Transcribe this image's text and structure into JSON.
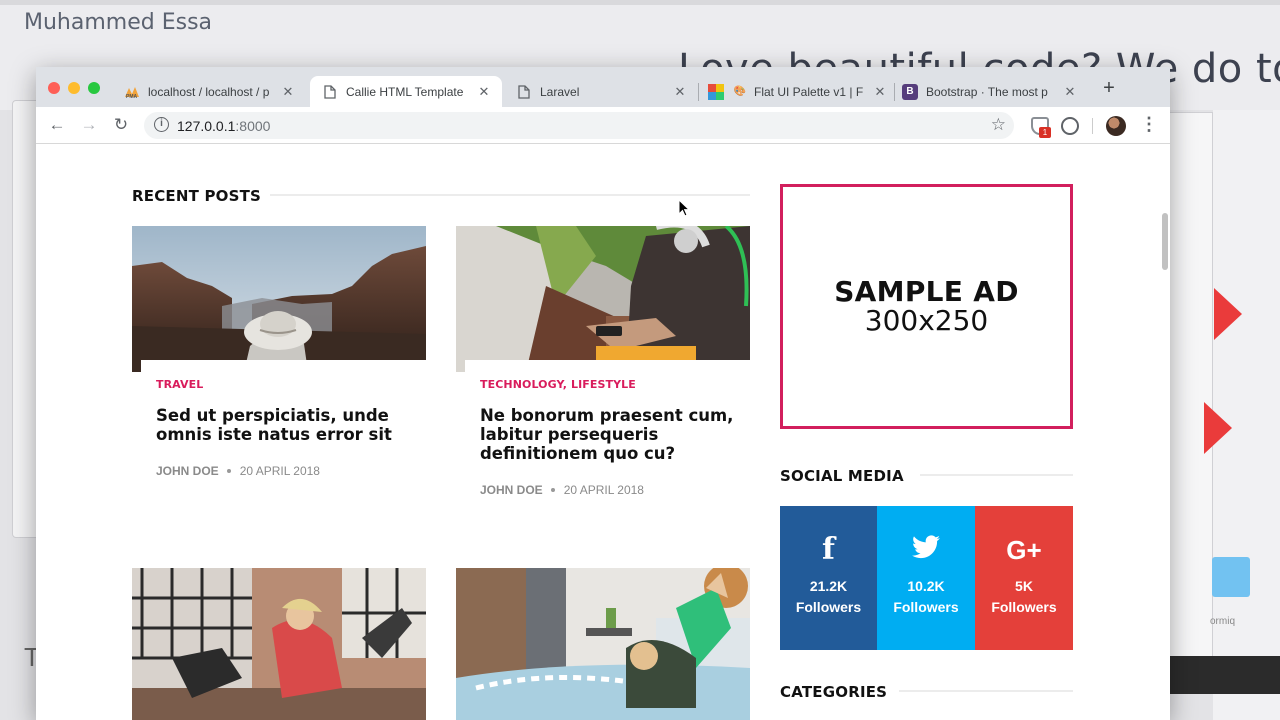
{
  "background": {
    "author": "Muhammed Essa",
    "slogan": "Love beautiful code? We do too.",
    "partial_letter": "T",
    "partial_label": "ormiq"
  },
  "browser": {
    "tabs": [
      {
        "title": "localhost / localhost / p",
        "favicon": "phpmyadmin-icon",
        "active": false
      },
      {
        "title": "Callie HTML Template",
        "favicon": "document-icon",
        "active": true
      },
      {
        "title": "Laravel",
        "favicon": "document-icon",
        "active": false
      },
      {
        "title": "Flat UI Palette v1 | F",
        "favicon": "palette-icon",
        "active": false
      },
      {
        "title": "Bootstrap · The most p",
        "favicon": "bootstrap-icon",
        "active": false
      }
    ],
    "url": {
      "host": "127.0.0.1",
      "port": ":8000"
    },
    "extension_badge": "1",
    "bootstrap_letter": "B"
  },
  "page": {
    "recent_posts_title": "RECENT POSTS",
    "posts": [
      {
        "category": "TRAVEL",
        "title": "Sed ut perspiciatis, unde omnis iste natus error sit",
        "author": "JOHN DOE",
        "date": "20 APRIL 2018"
      },
      {
        "category": "TECHNOLOGY, LIFESTYLE",
        "title": "Ne bonorum praesent cum, labitur persequeris definitionem quo cu?",
        "author": "JOHN DOE",
        "date": "20 APRIL 2018"
      }
    ],
    "ad": {
      "line1": "SAMPLE AD",
      "line2": "300x250"
    },
    "social_title": "SOCIAL MEDIA",
    "social": [
      {
        "network": "facebook",
        "glyph": "f",
        "count": "21.2K",
        "label": "Followers",
        "color": "#225b99"
      },
      {
        "network": "twitter",
        "glyph": "🐦",
        "count": "10.2K",
        "label": "Followers",
        "color": "#00adf2"
      },
      {
        "network": "google-plus",
        "glyph": "G+",
        "count": "5K",
        "label": "Followers",
        "color": "#e4403a"
      }
    ],
    "categories_title": "CATEGORIES"
  },
  "colors": {
    "accent": "#d91c5c",
    "ad_border": "#d21f5d"
  }
}
